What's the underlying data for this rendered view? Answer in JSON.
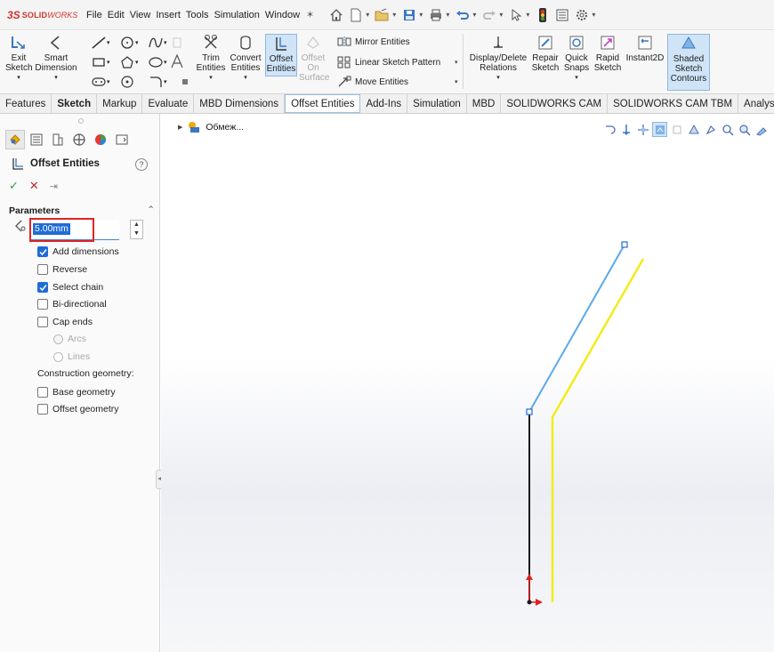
{
  "app": {
    "logo_ds": "3S",
    "logo_solid": "SOLID",
    "logo_works": "WORKS"
  },
  "menu": [
    "File",
    "Edit",
    "View",
    "Insert",
    "Tools",
    "Simulation",
    "Window"
  ],
  "ribbon": {
    "exit_sketch": [
      "Exit",
      "Sketch"
    ],
    "smart_dimension": [
      "Smart",
      "Dimension"
    ],
    "trim_entities": [
      "Trim",
      "Entities"
    ],
    "convert_entities": [
      "Convert",
      "Entities"
    ],
    "offset_entities": [
      "Offset",
      "Entities"
    ],
    "offset_on_surface": [
      "Offset",
      "On",
      "Surface"
    ],
    "mirror_entities": "Mirror Entities",
    "linear_sketch_pattern": "Linear Sketch Pattern",
    "move_entities": "Move Entities",
    "display_delete_relations": [
      "Display/Delete",
      "Relations"
    ],
    "repair_sketch": [
      "Repair",
      "Sketch"
    ],
    "quick_snaps": [
      "Quick",
      "Snaps"
    ],
    "rapid_sketch": [
      "Rapid",
      "Sketch"
    ],
    "instant2d": "Instant2D",
    "shaded_sketch_contours": [
      "Shaded",
      "Sketch",
      "Contours"
    ]
  },
  "tabs": [
    "Features",
    "Sketch",
    "Markup",
    "Evaluate",
    "MBD Dimensions",
    "Offset Entities",
    "Add-Ins",
    "Simulation",
    "MBD",
    "SOLIDWORKS CAM",
    "SOLIDWORKS CAM TBM",
    "Analysis Pr"
  ],
  "panel": {
    "title": "Offset Entities",
    "help": "?",
    "section": "Parameters",
    "offset_value": "5.00mm",
    "options": {
      "add_dimensions": {
        "label": "Add dimensions",
        "checked": true
      },
      "reverse": {
        "label": "Reverse",
        "checked": false
      },
      "select_chain": {
        "label": "Select chain",
        "checked": true
      },
      "bi_directional": {
        "label": "Bi-directional",
        "checked": false
      },
      "cap_ends": {
        "label": "Cap ends",
        "checked": false
      },
      "arcs": {
        "label": "Arcs",
        "enabled": false
      },
      "lines": {
        "label": "Lines",
        "enabled": false
      },
      "construction_geometry": "Construction geometry:",
      "base_geometry": {
        "label": "Base geometry",
        "checked": false
      },
      "offset_geometry": {
        "label": "Offset geometry",
        "checked": false
      }
    }
  },
  "viewport": {
    "tree_label": "Обмеж...",
    "colors": {
      "selected_line": "#5aa9ec",
      "offset_line": "#f2ec1a",
      "base_line": "#1a1a1a",
      "origin_axis": "#e02020"
    }
  }
}
